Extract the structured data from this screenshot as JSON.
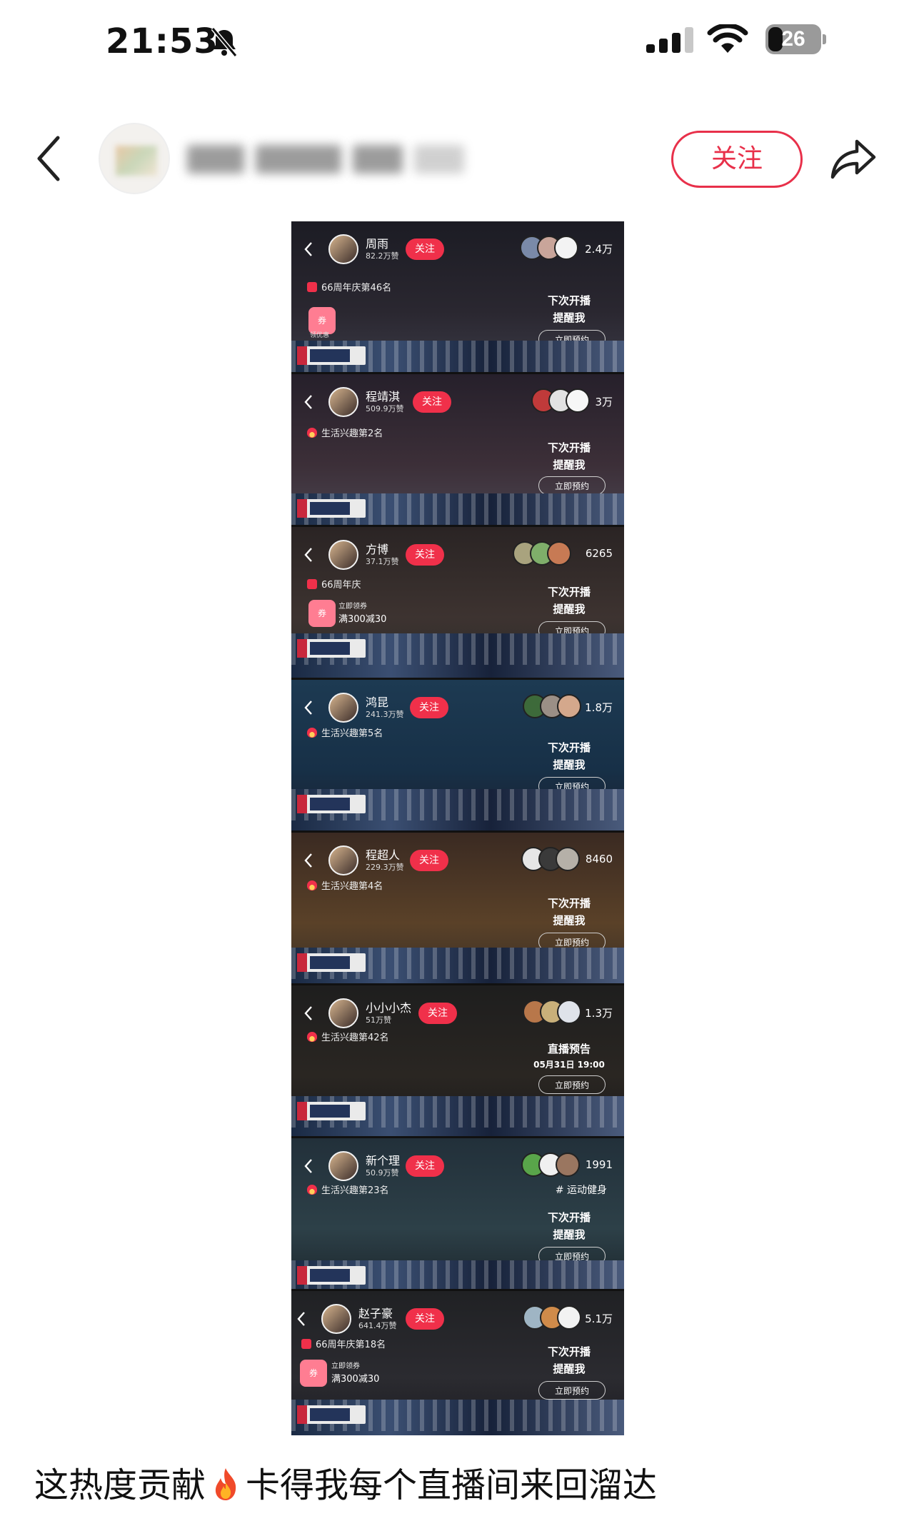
{
  "status": {
    "time": "21:53",
    "battery": "26"
  },
  "header": {
    "follow_label": "关注"
  },
  "panels": [
    {
      "name": "周雨",
      "likes": "82.2万赞",
      "follow": "关注",
      "count": "2.4万",
      "rank": "66周年庆第46名",
      "coupon_icon": "券",
      "coupon_small": "领优惠",
      "cta1": "下次开播",
      "cta2": "提醒我",
      "book": "立即预约"
    },
    {
      "name": "程靖淇",
      "likes": "509.9万赞",
      "follow": "关注",
      "count": "3万",
      "rank": "生活兴趣第2名",
      "cta1": "下次开播",
      "cta2": "提醒我",
      "book": "立即预约"
    },
    {
      "name": "方博",
      "likes": "37.1万赞",
      "follow": "关注",
      "count": "6265",
      "rank": "66周年庆",
      "coupon_icon": "券",
      "coupon_text": "立即领券",
      "coupon_big": "满300减30",
      "cta1": "下次开播",
      "cta2": "提醒我",
      "book": "立即预约"
    },
    {
      "name": "鸿昆",
      "likes": "241.3万赞",
      "follow": "关注",
      "count": "1.8万",
      "rank": "生活兴趣第5名",
      "cta1": "下次开播",
      "cta2": "提醒我",
      "book": "立即预约"
    },
    {
      "name": "程超人",
      "likes": "229.3万赞",
      "follow": "关注",
      "count": "8460",
      "rank": "生活兴趣第4名",
      "cta1": "下次开播",
      "cta2": "提醒我",
      "book": "立即预约"
    },
    {
      "name": "小小小杰",
      "likes": "51万赞",
      "follow": "关注",
      "count": "1.3万",
      "rank": "生活兴趣第42名",
      "cta1": "直播预告",
      "cta2": "05月31日 19:00",
      "book": "立即预约"
    },
    {
      "name": "新个理",
      "likes": "50.9万赞",
      "follow": "关注",
      "count": "1991",
      "rank": "生活兴趣第23名",
      "tag": "# 运动健身",
      "cta1": "下次开播",
      "cta2": "提醒我",
      "book": "立即预约"
    },
    {
      "name": "赵子豪",
      "likes": "641.4万赞",
      "follow": "关注",
      "count": "5.1万",
      "rank": "66周年庆第18名",
      "coupon_icon": "券",
      "coupon_text": "立即领券",
      "coupon_big": "满300减30",
      "cta1": "下次开播",
      "cta2": "提醒我",
      "book": "立即预约"
    }
  ],
  "caption": {
    "before": "这热度贡献",
    "after": "卡得我每个直播间来回溜达"
  }
}
